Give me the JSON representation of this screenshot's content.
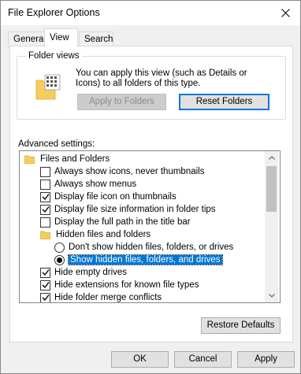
{
  "window": {
    "title": "File Explorer Options"
  },
  "tabs": [
    {
      "label": "General",
      "active": false
    },
    {
      "label": "View",
      "active": true
    },
    {
      "label": "Search",
      "active": false
    }
  ],
  "folder_views": {
    "legend": "Folder views",
    "description": "You can apply this view (such as Details or Icons) to all folders of this type.",
    "apply_button": "Apply to Folders",
    "reset_button": "Reset Folders"
  },
  "advanced": {
    "label": "Advanced settings:",
    "items": [
      {
        "type": "folder",
        "label": "Files and Folders"
      },
      {
        "type": "checkbox",
        "label": "Always show icons, never thumbnails",
        "checked": false
      },
      {
        "type": "checkbox",
        "label": "Always show menus",
        "checked": false
      },
      {
        "type": "checkbox",
        "label": "Display file icon on thumbnails",
        "checked": true
      },
      {
        "type": "checkbox",
        "label": "Display file size information in folder tips",
        "checked": true
      },
      {
        "type": "checkbox",
        "label": "Display the full path in the title bar",
        "checked": false
      },
      {
        "type": "folder",
        "label": "Hidden files and folders"
      },
      {
        "type": "radio",
        "label": "Don't show hidden files, folders, or drives",
        "checked": false
      },
      {
        "type": "radio",
        "label": "Show hidden files, folders, and drives",
        "checked": true
      },
      {
        "type": "checkbox",
        "label": "Hide empty drives",
        "checked": true
      },
      {
        "type": "checkbox",
        "label": "Hide extensions for known file types",
        "checked": true
      },
      {
        "type": "checkbox",
        "label": "Hide folder merge conflicts",
        "checked": true
      }
    ],
    "restore_button": "Restore Defaults"
  },
  "footer": {
    "ok": "OK",
    "cancel": "Cancel",
    "apply": "Apply"
  },
  "icons": {
    "close": "close-icon",
    "folder_views": "folder-grid-icon",
    "folder": "folder-icon",
    "checkmark": "checkmark-icon"
  },
  "colors": {
    "accent": "#0078d7",
    "folder": "#f5cd5c"
  }
}
